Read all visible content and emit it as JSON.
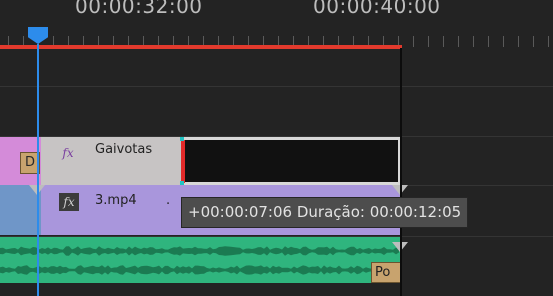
{
  "ruler": {
    "timecode_left": "00:00:32:00",
    "timecode_right": "00:00:40:00"
  },
  "tracks": {
    "title_track": {
      "left_badge": "D",
      "clip_label": "Gaivotas",
      "fx_label": "fx"
    },
    "video_track": {
      "clip_label": "3.mp4",
      "fx_label": "fx",
      "dot": "."
    },
    "audio_track": {
      "badge_label": "Po"
    }
  },
  "tooltip": {
    "text": "+00:00:07:06 Duração: 00:00:12:05"
  },
  "colors": {
    "playhead": "#2d8ceb",
    "work_area": "#e23a2d",
    "title_clip": "#c7c4c4",
    "video_clip": "#a996dc",
    "audio_clip": "#2fb57e"
  }
}
